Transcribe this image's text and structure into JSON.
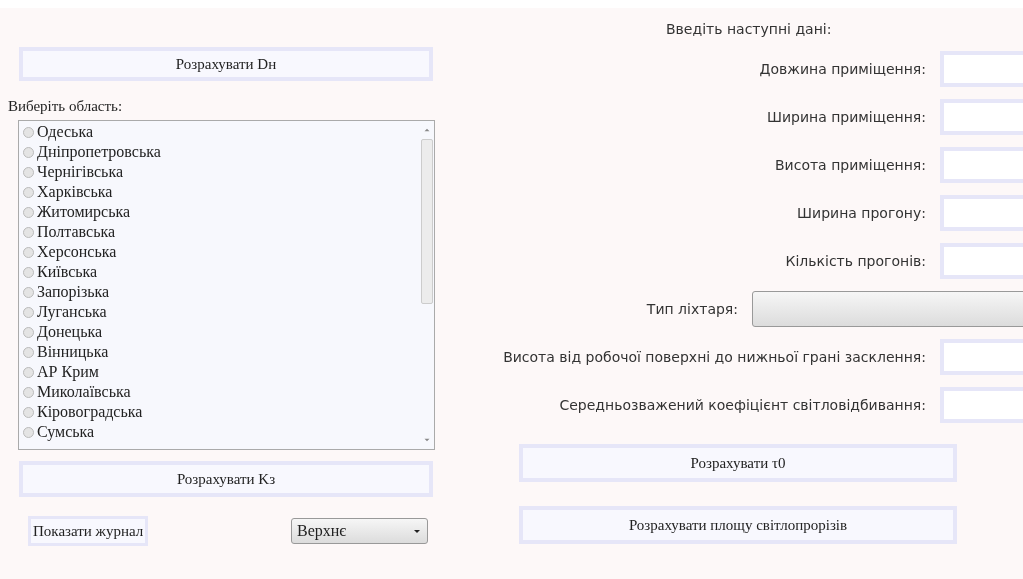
{
  "left": {
    "calc_dn_button": "Розрахувати Dн",
    "region_label": "Виберіть область:",
    "regions": [
      {
        "label": "Одеська",
        "selected": false
      },
      {
        "label": "Дніпропетровська",
        "selected": false
      },
      {
        "label": "Чернігівська",
        "selected": false
      },
      {
        "label": "Харківська",
        "selected": false
      },
      {
        "label": "Житомирська",
        "selected": false
      },
      {
        "label": "Полтавська",
        "selected": false
      },
      {
        "label": "Херсонська",
        "selected": false
      },
      {
        "label": "Київська",
        "selected": false
      },
      {
        "label": "Запорізька",
        "selected": false
      },
      {
        "label": "Луганська",
        "selected": false
      },
      {
        "label": "Донецька",
        "selected": false
      },
      {
        "label": "Вінницька",
        "selected": false
      },
      {
        "label": "АР Крим",
        "selected": false
      },
      {
        "label": "Миколаївська",
        "selected": false
      },
      {
        "label": "Кіровоградська",
        "selected": false
      },
      {
        "label": "Сумська",
        "selected": false
      }
    ],
    "calc_kz_button": "Розрахувати Kз",
    "log_button": "Показати журнал",
    "position_select": "Верхнє"
  },
  "right": {
    "title": "Введіть наступні дані:",
    "fields": [
      {
        "kind": "input",
        "label": "Довжина приміщення:"
      },
      {
        "kind": "input",
        "label": "Ширина приміщення:"
      },
      {
        "kind": "input",
        "label": "Висота приміщення:"
      },
      {
        "kind": "input",
        "label": "Ширина прогону:"
      },
      {
        "kind": "input",
        "label": "Кількість прогонів:"
      },
      {
        "kind": "select",
        "label": "Тип ліхтаря:"
      },
      {
        "kind": "input",
        "label": "Висота від робочої поверхні до нижньої грані засклення:"
      },
      {
        "kind": "input",
        "label": "Середньозважений коефіцієнт світловідбивання:"
      }
    ],
    "buttons": [
      "Розрахувати τ0",
      "Розрахувати площу світлопрорізів"
    ]
  }
}
